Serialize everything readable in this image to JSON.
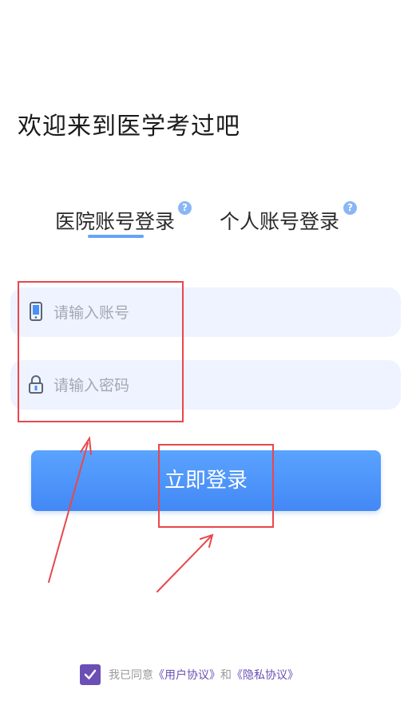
{
  "welcome": "欢迎来到医学考过吧",
  "tabs": [
    {
      "label": "医院账号登录",
      "active": true
    },
    {
      "label": "个人账号登录",
      "active": false
    }
  ],
  "help_symbol": "?",
  "account": {
    "placeholder": "请输入账号",
    "icon": "phone-icon"
  },
  "password": {
    "placeholder": "请输入密码",
    "icon": "lock-icon"
  },
  "login_button": "立即登录",
  "agreement": {
    "checked": true,
    "prefix": "我已同意",
    "user_agreement": "《用户协议》",
    "joiner": "和",
    "privacy_policy": "《隐私协议》"
  },
  "colors": {
    "primary": "#4a90f5",
    "accent": "#6b4fb5",
    "annotation": "#e8474c",
    "field_bg": "#eef3ff"
  }
}
